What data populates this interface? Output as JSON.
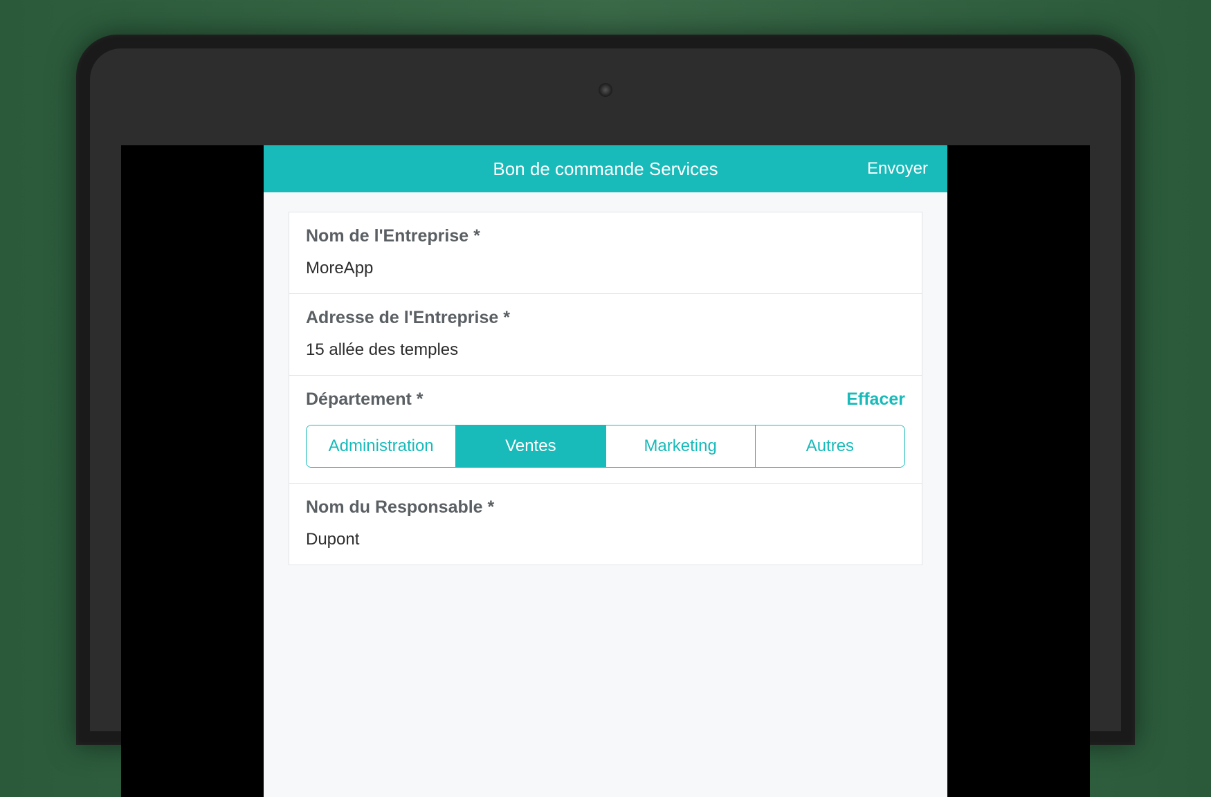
{
  "header": {
    "title": "Bon de commande Services",
    "submit_label": "Envoyer"
  },
  "form": {
    "company_name": {
      "label": "Nom de l'Entreprise *",
      "value": "MoreApp"
    },
    "company_address": {
      "label": "Adresse de l'Entreprise *",
      "value": "15 allée des temples"
    },
    "department": {
      "label": "Département *",
      "clear_label": "Effacer",
      "options": [
        "Administration",
        "Ventes",
        "Marketing",
        "Autres"
      ],
      "selected_index": 1
    },
    "responsible_name": {
      "label": "Nom du Responsable *",
      "value": "Dupont"
    }
  },
  "colors": {
    "accent": "#18baba"
  }
}
